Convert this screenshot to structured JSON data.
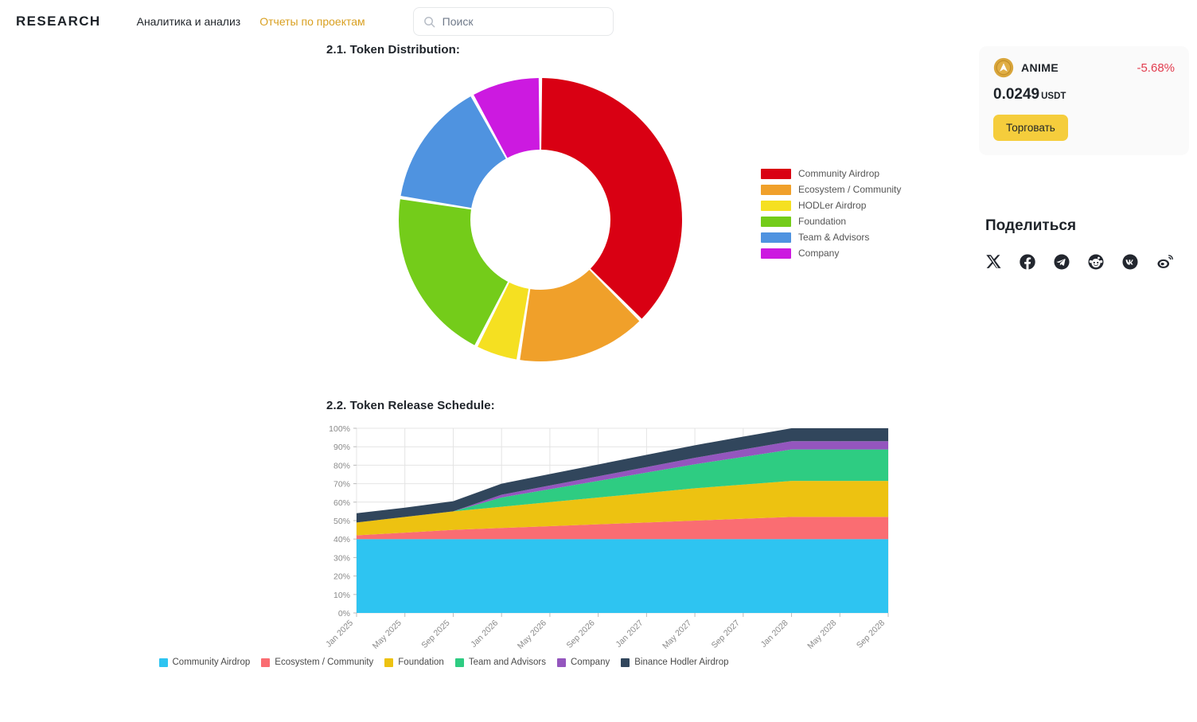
{
  "header": {
    "brand": "RESEARCH",
    "nav": [
      {
        "label": "Аналитика и анализ",
        "active": false
      },
      {
        "label": "Отчеты по проектам",
        "active": true
      }
    ],
    "search": {
      "placeholder": "Поиск",
      "value": "",
      "icon": "search-icon"
    }
  },
  "sections": {
    "distribution_title": "2.1. Token Distribution:",
    "schedule_title": "2.2. Token Release Schedule:"
  },
  "ticker": {
    "symbol": "ANIME",
    "change": "-5.68%",
    "change_color": "#e23c4e",
    "price": "0.0249",
    "price_unit": "USDT",
    "trade_label": "Торговать",
    "trade_color": "#f5cd3c",
    "icon": "anime-coin-icon"
  },
  "share": {
    "title": "Поделиться",
    "items": [
      {
        "name": "x-twitter-icon",
        "label": "X"
      },
      {
        "name": "facebook-icon",
        "label": "Facebook"
      },
      {
        "name": "telegram-icon",
        "label": "Telegram"
      },
      {
        "name": "reddit-icon",
        "label": "Reddit"
      },
      {
        "name": "vk-icon",
        "label": "VK"
      },
      {
        "name": "weibo-icon",
        "label": "Weibo"
      }
    ]
  },
  "chart_data": [
    {
      "type": "pie",
      "title": "2.1. Token Distribution:",
      "donut": true,
      "legend_position": "right",
      "categories": [
        "Community Airdrop",
        "Ecosystem / Community",
        "HODLer Airdrop",
        "Foundation",
        "Team & Advisors",
        "Company"
      ],
      "values": [
        37.5,
        15.0,
        5.0,
        20.0,
        14.5,
        8.0
      ],
      "colors": [
        "#d90013",
        "#f0a02a",
        "#f5e021",
        "#74cc1a",
        "#4f93e0",
        "#cc1ae0"
      ]
    },
    {
      "type": "area",
      "title": "2.2. Token Release Schedule:",
      "stacked": true,
      "percent": true,
      "xlabel": "",
      "ylabel": "",
      "ylim": [
        0,
        100
      ],
      "ytick_labels": [
        "0%",
        "10%",
        "20%",
        "30%",
        "40%",
        "50%",
        "60%",
        "70%",
        "80%",
        "90%",
        "100%"
      ],
      "grid": true,
      "legend_position": "bottom",
      "x": [
        "Jan 2025",
        "May 2025",
        "Sep 2025",
        "Jan 2026",
        "May 2026",
        "Sep 2026",
        "Jan 2027",
        "May 2027",
        "Sep 2027",
        "Jan 2028",
        "May 2028",
        "Sep 2028"
      ],
      "series": [
        {
          "name": "Community Airdrop",
          "color": "#2ec4f1",
          "values": [
            40,
            40,
            40,
            40,
            40,
            40,
            40,
            40,
            40,
            40,
            40,
            40
          ]
        },
        {
          "name": "Ecosystem / Community",
          "color": "#fa6d72",
          "values": [
            2,
            3.5,
            5,
            6,
            7,
            8,
            9,
            10,
            11,
            12,
            12,
            12
          ]
        },
        {
          "name": "Foundation",
          "color": "#edc211",
          "values": [
            7,
            8.5,
            10,
            11.5,
            13,
            14.5,
            16,
            17.5,
            18.5,
            19.5,
            19.5,
            19.5
          ]
        },
        {
          "name": "Team and Advisors",
          "color": "#2ecc82",
          "values": [
            0,
            0,
            0,
            5,
            7,
            9,
            11,
            13,
            15,
            17,
            17,
            17
          ]
        },
        {
          "name": "Company",
          "color": "#9456be",
          "values": [
            0,
            0,
            0,
            1.5,
            2,
            2.5,
            3,
            3.5,
            4,
            4.5,
            4.5,
            4.5
          ]
        },
        {
          "name": "Binance Hodler Airdrop",
          "color": "#31465c",
          "values": [
            5,
            5,
            5.5,
            6,
            6.2,
            6.4,
            6.6,
            6.8,
            7,
            7,
            7,
            7
          ]
        }
      ]
    }
  ]
}
